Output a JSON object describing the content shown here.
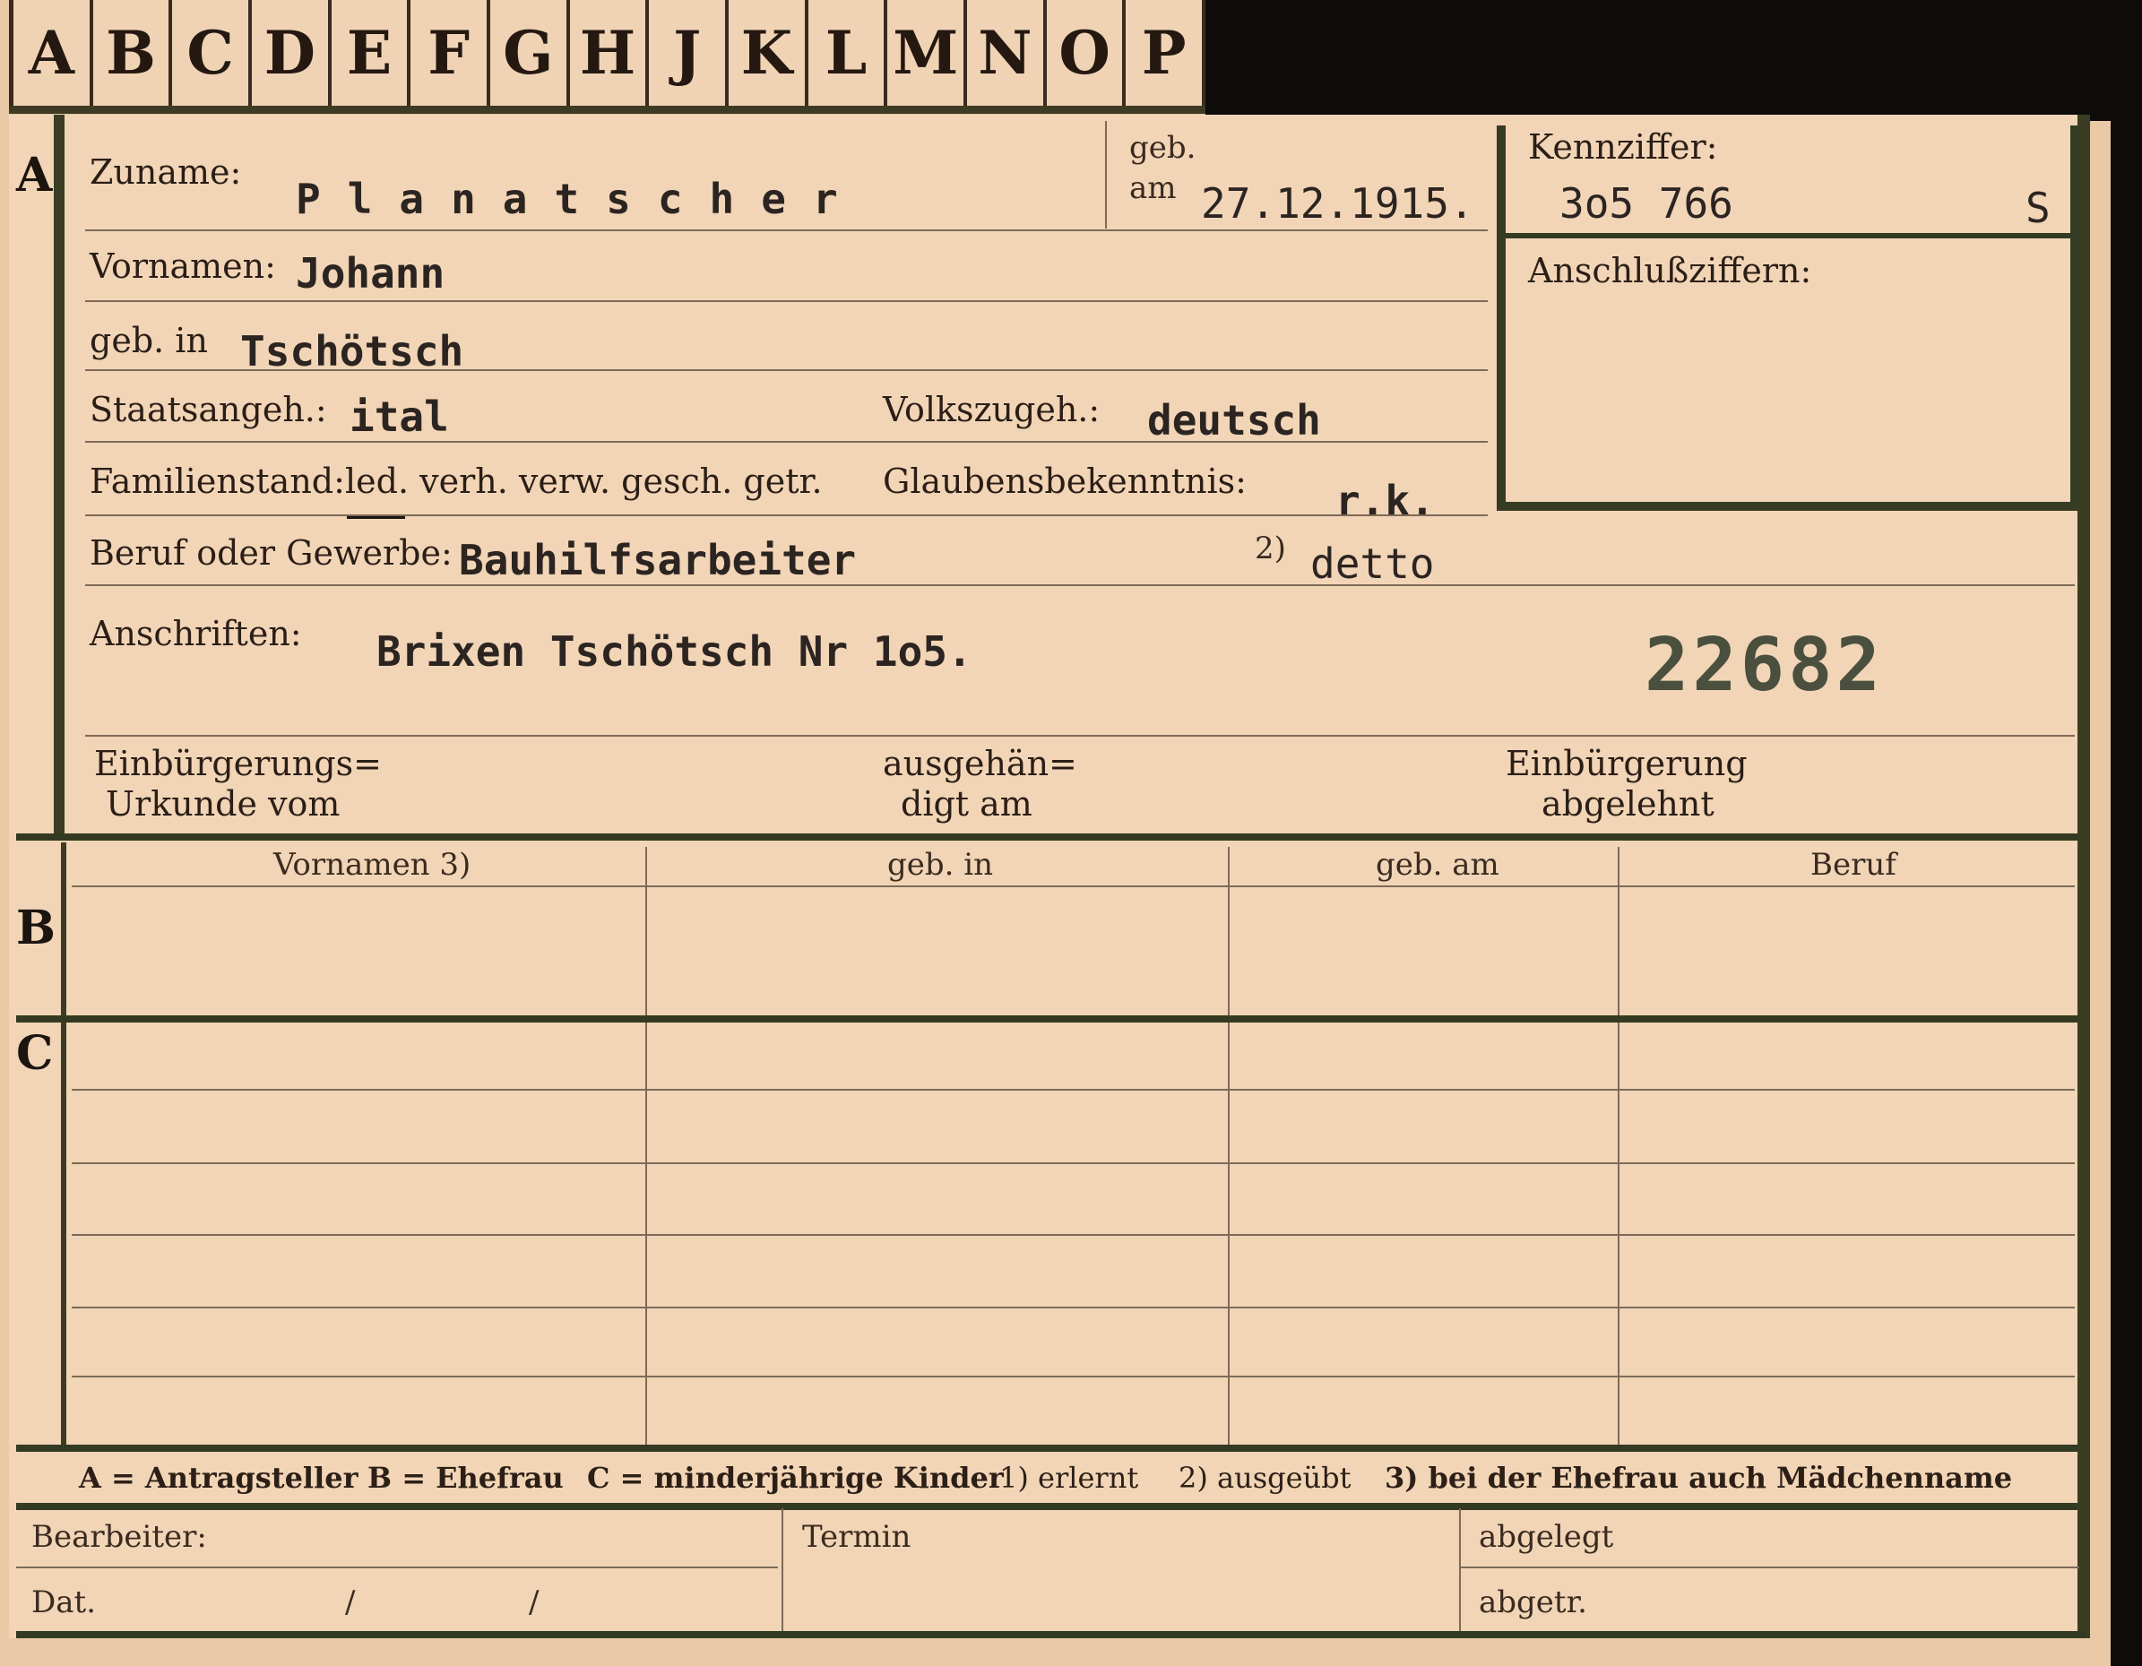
{
  "tabs": [
    "A",
    "B",
    "C",
    "D",
    "E",
    "F",
    "G",
    "H",
    "J",
    "K",
    "L",
    "M",
    "N",
    "O",
    "P"
  ],
  "section_a": {
    "letter": "A",
    "zuname_label": "Zuname:",
    "zuname_value": "Planatscher",
    "geb_label": "geb.",
    "am_label": "am",
    "geb_am_value": "27.12.1915.",
    "kennziffer_label": "Kennziffer:",
    "kennziffer_value": "3o5 766",
    "kennziffer_suffix": "S",
    "anschluss_label": "Anschlußziffern:",
    "vornamen_label": "Vornamen:",
    "vornamen_value": "Johann",
    "geb_in_label": "geb. in",
    "geb_in_value": "Tschötsch",
    "staatsangeh_label": "Staatsangeh.:",
    "staatsangeh_value": "ital",
    "volkszugeh_label": "Volkszugeh.:",
    "volkszugeh_value": "deutsch",
    "familienstand_label": "Familienstand:",
    "familienstand_options": "led. verh. verw. gesch. getr.",
    "glaubens_label": "Glaubensbekenntnis:",
    "glaubens_value": "r.k.",
    "beruf_label": "Beruf oder Gewerbe:",
    "beruf_value": "Bauhilfsarbeiter",
    "footnote2": "2)",
    "beruf_ausgeuebt_value": "detto",
    "anschriften_label": "Anschriften:",
    "anschriften_value": "Brixen Tschötsch Nr 1o5.",
    "stamp_number": "22682",
    "einbuergerung_label_1": "Einbürgerungs=",
    "einbuergerung_label_2": "Urkunde vom",
    "ausgehaendigt_label_1": "ausgehän=",
    "ausgehaendigt_label_2": "digt am",
    "abgelehnt_label_1": "Einbürgerung",
    "abgelehnt_label_2": "abgelehnt"
  },
  "section_b": {
    "letter": "B",
    "columns": [
      "Vornamen 3)",
      "geb. in",
      "geb. am",
      "Beruf"
    ]
  },
  "section_c": {
    "letter": "C"
  },
  "legend": {
    "a": "A = Antragsteller",
    "b": "B = Ehefrau",
    "c": "C = minderjährige Kinder",
    "f1": "1) erlernt",
    "f2": "2) ausgeübt",
    "f3": "3) bei der Ehefrau auch Mädchenname"
  },
  "footer": {
    "bearbeiter_label": "Bearbeiter:",
    "dat_label": "Dat.",
    "slash": "/",
    "termin_label": "Termin",
    "abgelegt_label": "abgelegt",
    "abgetr_label": "abgetr."
  }
}
